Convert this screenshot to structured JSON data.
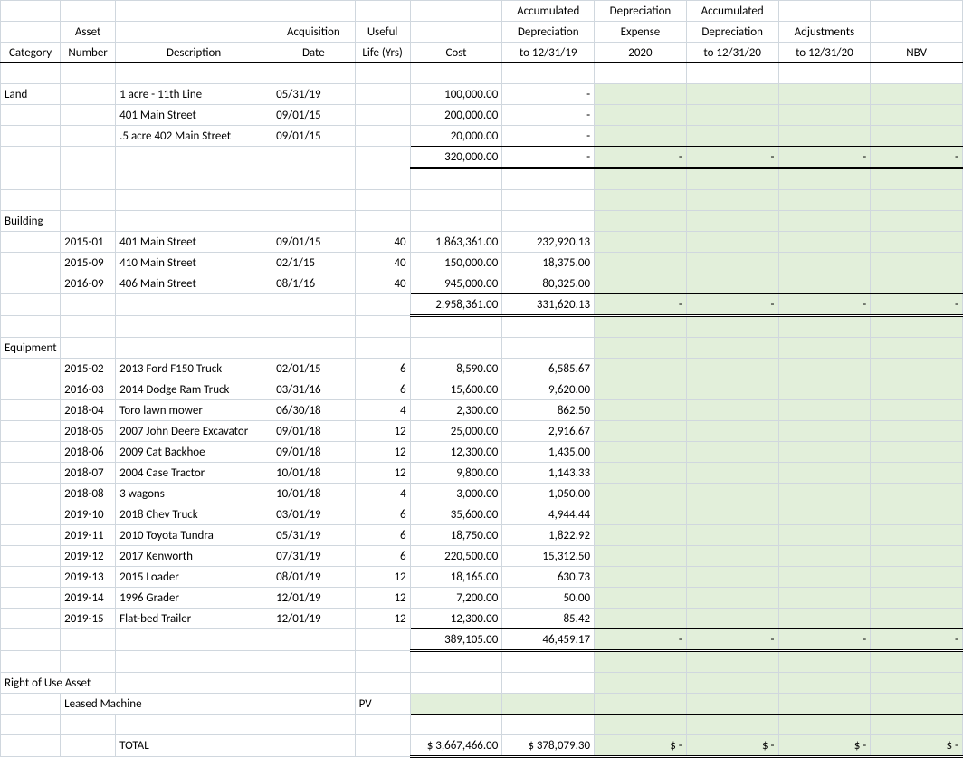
{
  "headers": {
    "row1": [
      "",
      "",
      "",
      "",
      "",
      "",
      "Accumulated",
      "Depreciation",
      "Accumulated",
      "",
      ""
    ],
    "row2": [
      "",
      "Asset",
      "",
      "Acquisition",
      "Useful",
      "",
      "Depreciation",
      "Expense",
      "Depreciation",
      "Adjustments",
      ""
    ],
    "row3": [
      "Category",
      "Number",
      "Description",
      "Date",
      "Life (Yrs)",
      "Cost",
      "to 12/31/19",
      "2020",
      "to 12/31/20",
      "to 12/31/20",
      "NBV"
    ]
  },
  "sections": {
    "land": {
      "title": "Land",
      "rows": [
        {
          "num": "",
          "desc": "1 acre - 11th Line",
          "date": "05/31/19",
          "life": "",
          "cost": "100,000.00",
          "acc19": "-"
        },
        {
          "num": "",
          "desc": "401 Main Street",
          "date": "09/01/15",
          "life": "",
          "cost": "200,000.00",
          "acc19": "-"
        },
        {
          "num": "",
          "desc": ".5 acre 402 Main Street",
          "date": "09/01/15",
          "life": "",
          "cost": "20,000.00",
          "acc19": "-"
        }
      ],
      "subtotal": {
        "cost": "320,000.00",
        "acc19": "-",
        "exp": "-",
        "acc20": "-",
        "adj": "-",
        "nbv": "-"
      }
    },
    "building": {
      "title": "Building",
      "rows": [
        {
          "num": "2015-01",
          "desc": "401 Main Street",
          "date": "09/01/15",
          "life": "40",
          "cost": "1,863,361.00",
          "acc19": "232,920.13"
        },
        {
          "num": "2015-09",
          "desc": "410 Main Street",
          "date": "02/1/15",
          "life": "40",
          "cost": "150,000.00",
          "acc19": "18,375.00"
        },
        {
          "num": "2016-09",
          "desc": "406 Main Street",
          "date": "08/1/16",
          "life": "40",
          "cost": "945,000.00",
          "acc19": "80,325.00"
        }
      ],
      "subtotal": {
        "cost": "2,958,361.00",
        "acc19": "331,620.13",
        "exp": "-",
        "acc20": "-",
        "adj": "-",
        "nbv": "-"
      }
    },
    "equipment": {
      "title": "Equipment",
      "rows": [
        {
          "num": "2015-02",
          "desc": "2013 Ford F150 Truck",
          "date": "02/01/15",
          "life": "6",
          "cost": "8,590.00",
          "acc19": "6,585.67"
        },
        {
          "num": "2016-03",
          "desc": "2014 Dodge Ram Truck",
          "date": "03/31/16",
          "life": "6",
          "cost": "15,600.00",
          "acc19": "9,620.00"
        },
        {
          "num": "2018-04",
          "desc": "Toro lawn mower",
          "date": "06/30/18",
          "life": "4",
          "cost": "2,300.00",
          "acc19": "862.50"
        },
        {
          "num": "2018-05",
          "desc": "2007 John Deere Excavator",
          "date": "09/01/18",
          "life": "12",
          "cost": "25,000.00",
          "acc19": "2,916.67"
        },
        {
          "num": "2018-06",
          "desc": "2009 Cat Backhoe",
          "date": "09/01/18",
          "life": "12",
          "cost": "12,300.00",
          "acc19": "1,435.00"
        },
        {
          "num": "2018-07",
          "desc": "2004 Case Tractor",
          "date": "10/01/18",
          "life": "12",
          "cost": "9,800.00",
          "acc19": "1,143.33"
        },
        {
          "num": "2018-08",
          "desc": "3 wagons",
          "date": "10/01/18",
          "life": "4",
          "cost": "3,000.00",
          "acc19": "1,050.00"
        },
        {
          "num": "2019-10",
          "desc": "2018 Chev Truck",
          "date": "03/01/19",
          "life": "6",
          "cost": "35,600.00",
          "acc19": "4,944.44"
        },
        {
          "num": "2019-11",
          "desc": "2010 Toyota Tundra",
          "date": "05/31/19",
          "life": "6",
          "cost": "18,750.00",
          "acc19": "1,822.92"
        },
        {
          "num": "2019-12",
          "desc": "2017 Kenworth",
          "date": "07/31/19",
          "life": "6",
          "cost": "220,500.00",
          "acc19": "15,312.50"
        },
        {
          "num": "2019-13",
          "desc": "2015 Loader",
          "date": "08/01/19",
          "life": "12",
          "cost": "18,165.00",
          "acc19": "630.73"
        },
        {
          "num": "2019-14",
          "desc": "1996 Grader",
          "date": "12/01/19",
          "life": "12",
          "cost": "7,200.00",
          "acc19": "50.00"
        },
        {
          "num": "2019-15",
          "desc": "Flat-bed Trailer",
          "date": "12/01/19",
          "life": "12",
          "cost": "12,300.00",
          "acc19": "85.42"
        }
      ],
      "subtotal": {
        "cost": "389,105.00",
        "acc19": "46,459.17",
        "exp": "-",
        "acc20": "-",
        "adj": "-",
        "nbv": "-"
      }
    },
    "rou": {
      "title": "Right of Use Asset",
      "rowLabel": "Leased Machine",
      "pvLabel": "PV"
    }
  },
  "total": {
    "label": "TOTAL",
    "cost": "$ 3,667,466.00",
    "acc19": "$   378,079.30",
    "exp": "$               -",
    "acc20": "$               -",
    "adj": "$               -",
    "nbv": "$               -"
  }
}
